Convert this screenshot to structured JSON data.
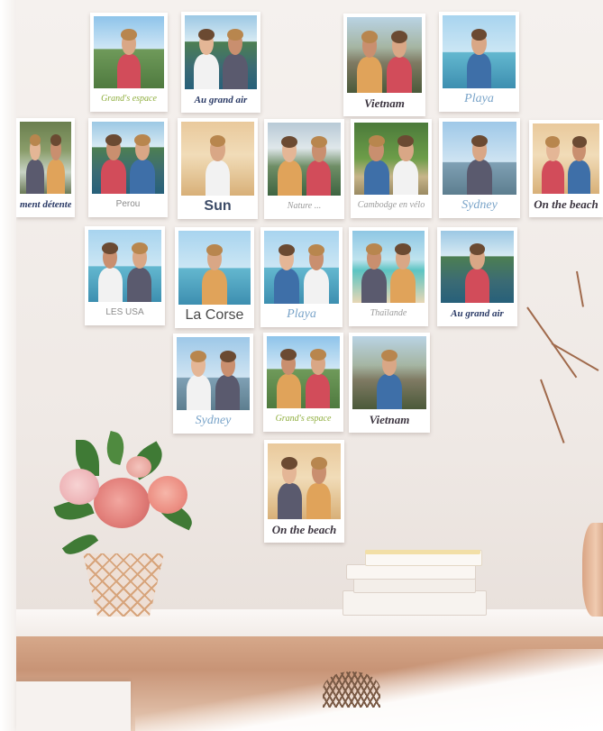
{
  "photos": [
    {
      "caption": "Grand's espace",
      "scene": "sky-blue",
      "style": "c-green"
    },
    {
      "caption": "Au grand air",
      "scene": "sky-lake",
      "style": "c-navy"
    },
    {
      "caption": "Vietnam",
      "scene": "sky-rock",
      "style": "c-dark"
    },
    {
      "caption": "Playa",
      "scene": "sky-sea",
      "style": "c-scriptlight"
    },
    {
      "caption": "ment détente",
      "scene": "forest",
      "style": "c-navy"
    },
    {
      "caption": "Perou",
      "scene": "sky-lake",
      "style": "c-small"
    },
    {
      "caption": "Sun",
      "scene": "beach",
      "style": "c-bold"
    },
    {
      "caption": "Nature ...",
      "scene": "heart",
      "style": "c-grey"
    },
    {
      "caption": "Cambodge en vélo",
      "scene": "bike",
      "style": "c-grey"
    },
    {
      "caption": "Sydney",
      "scene": "city",
      "style": "c-scriptlight"
    },
    {
      "caption": "On the beach",
      "scene": "beach",
      "style": "c-dark"
    },
    {
      "caption": "LES USA",
      "scene": "sky-sea",
      "style": "c-small"
    },
    {
      "caption": "La Corse",
      "scene": "sky-sea",
      "style": "c-sans"
    },
    {
      "caption": "Playa",
      "scene": "sky-sea",
      "style": "c-scriptlight"
    },
    {
      "caption": "Thaïlande",
      "scene": "thai",
      "style": "c-grey"
    },
    {
      "caption": "Au grand air",
      "scene": "sky-lake",
      "style": "c-navy"
    },
    {
      "caption": "Sydney",
      "scene": "city",
      "style": "c-scriptlight"
    },
    {
      "caption": "Grand's espace",
      "scene": "sky-blue",
      "style": "c-green"
    },
    {
      "caption": "Vietnam",
      "scene": "sky-rock",
      "style": "c-dark"
    },
    {
      "caption": "On the beach",
      "scene": "beach",
      "style": "c-dark"
    }
  ]
}
